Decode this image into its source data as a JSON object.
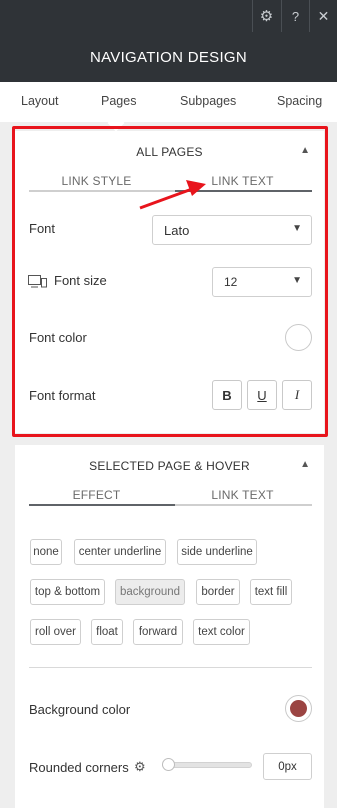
{
  "topbar": {
    "icons": [
      "gear-icon",
      "help-icon",
      "close-icon"
    ],
    "help_glyph": "?",
    "close_glyph": "✕",
    "gear_glyph": "⚙"
  },
  "header": {
    "title": "NAVIGATION DESIGN"
  },
  "tabs": [
    {
      "label": "Layout"
    },
    {
      "label": "Pages"
    },
    {
      "label": "Subpages"
    },
    {
      "label": "Spacing"
    }
  ],
  "all_pages": {
    "title": "ALL PAGES",
    "subtabs": [
      {
        "label": "LINK STYLE"
      },
      {
        "label": "LINK TEXT"
      }
    ],
    "font": {
      "label": "Font",
      "value": "Lato"
    },
    "font_size": {
      "label": "Font size",
      "value": "12"
    },
    "font_color": {
      "label": "Font color",
      "color": "#ffffff"
    },
    "font_format": {
      "label": "Font format",
      "bold": "B",
      "underline": "U",
      "italic": "I"
    }
  },
  "selected_hover": {
    "title": "SELECTED PAGE & HOVER",
    "subtabs": [
      {
        "label": "EFFECT"
      },
      {
        "label": "LINK TEXT"
      }
    ],
    "effects": [
      "none",
      "center underline",
      "side underline",
      "top & bottom",
      "background",
      "border",
      "text fill",
      "roll over",
      "float",
      "forward",
      "text color"
    ],
    "active_effect": "background",
    "background_color": {
      "label": "Background color",
      "color": "#9b4442"
    },
    "rounded_corners": {
      "label": "Rounded corners",
      "value": "0px",
      "slider_fraction": 0
    }
  },
  "colors": {
    "dark_bar": "#2f3337",
    "accent_line": "#5f6368",
    "annotation_red": "#e8141c"
  }
}
